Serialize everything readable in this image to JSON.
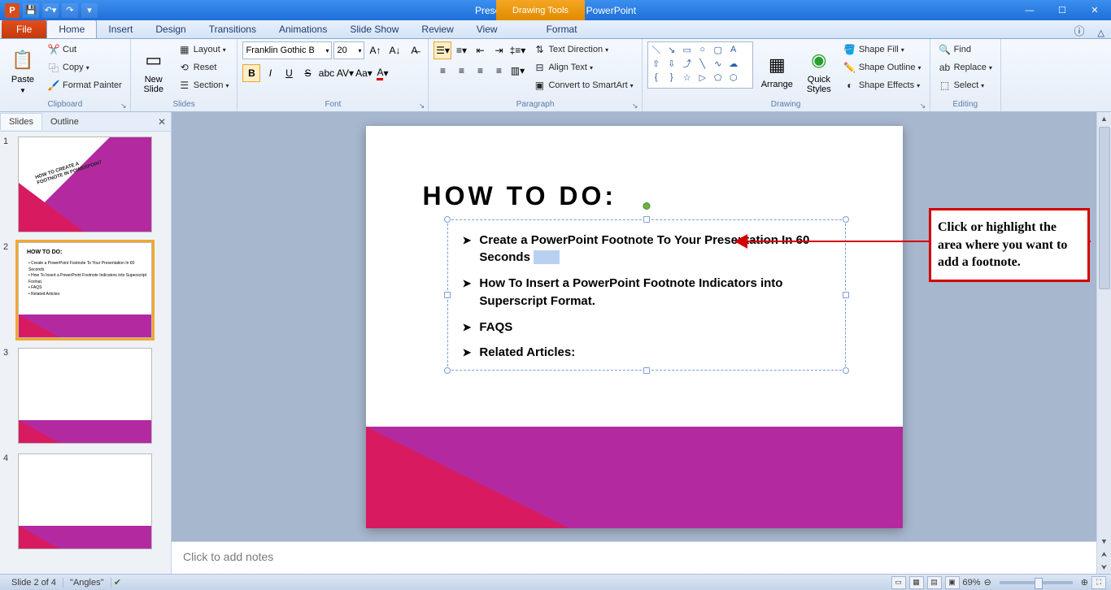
{
  "title": "Presentation1 - Microsoft PowerPoint",
  "contextual_tab": "Drawing Tools",
  "tabs": {
    "file": "File",
    "home": "Home",
    "insert": "Insert",
    "design": "Design",
    "transitions": "Transitions",
    "animations": "Animations",
    "slideshow": "Slide Show",
    "review": "Review",
    "view": "View",
    "format": "Format"
  },
  "ribbon": {
    "clipboard": {
      "label": "Clipboard",
      "paste": "Paste",
      "cut": "Cut",
      "copy": "Copy",
      "format_painter": "Format Painter"
    },
    "slides": {
      "label": "Slides",
      "new_slide": "New\nSlide",
      "layout": "Layout",
      "reset": "Reset",
      "section": "Section"
    },
    "font": {
      "label": "Font",
      "name": "Franklin Gothic B",
      "size": "20"
    },
    "paragraph": {
      "label": "Paragraph",
      "text_direction": "Text Direction",
      "align_text": "Align Text",
      "convert": "Convert to SmartArt"
    },
    "drawing": {
      "label": "Drawing",
      "arrange": "Arrange",
      "quick_styles": "Quick\nStyles",
      "shape_fill": "Shape Fill",
      "shape_outline": "Shape Outline",
      "shape_effects": "Shape Effects"
    },
    "editing": {
      "label": "Editing",
      "find": "Find",
      "replace": "Replace",
      "select": "Select"
    }
  },
  "panel": {
    "slides": "Slides",
    "outline": "Outline"
  },
  "thumb1": {
    "line1": "HOW TO CREATE A",
    "line2": "FOOTNOTE IN POWERPOINT"
  },
  "thumb2": {
    "title": "HOW TO DO:",
    "b1": "Create a PowerPoint Footnote To Your Presentation In 60 Seconds",
    "b2": "How To Insert a PowerPoint Footnote Indicators into Superscript Format.",
    "b3": "FAQS",
    "b4": "Related Articles:"
  },
  "slide": {
    "title": "HOW TO DO:",
    "bullets": {
      "b1": "Create a PowerPoint Footnote To Your Presentation In 60 Seconds",
      "b2": "How To Insert a PowerPoint Footnote Indicators into Superscript Format.",
      "b3": "FAQS",
      "b4": "Related Articles:"
    }
  },
  "callout": "Click or highlight the area where you want to add a footnote.",
  "notes_placeholder": "Click to add notes",
  "status": {
    "slide": "Slide 2 of 4",
    "theme": "\"Angles\"",
    "zoom": "69%"
  }
}
